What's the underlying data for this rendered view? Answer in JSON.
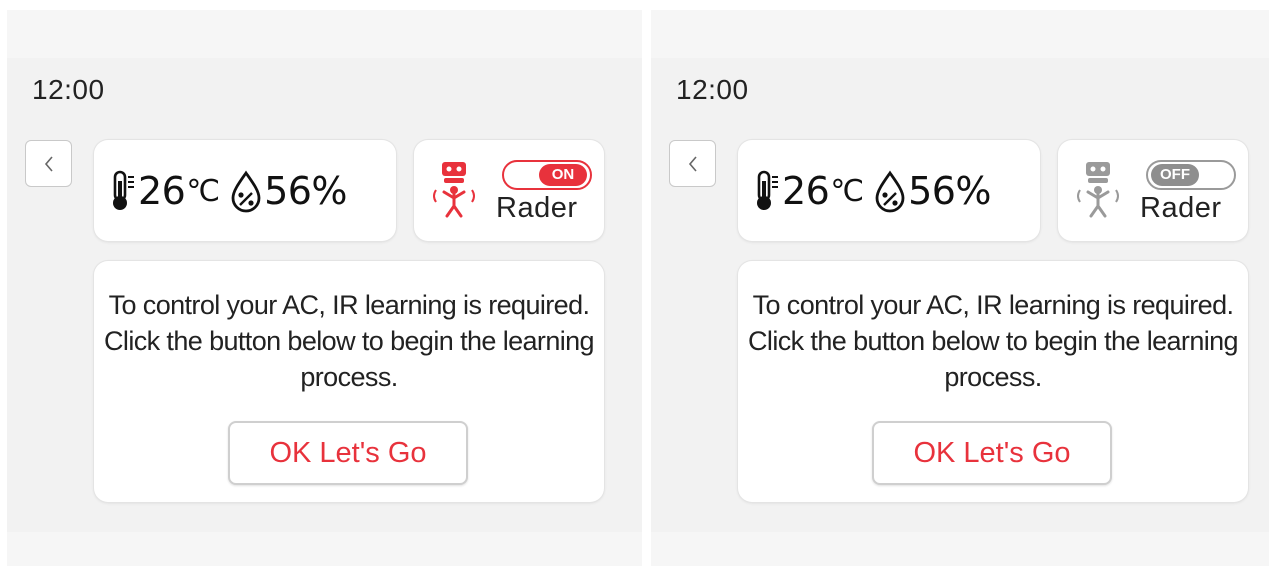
{
  "screens": [
    {
      "time": "12:00",
      "temperature": "26",
      "temperature_unit": "℃",
      "humidity": "56%",
      "radar_label": "Rader",
      "radar_toggle_label": "ON",
      "radar_on": true,
      "message": "To control your AC, IR learning is required. Click the button below to begin the learning process.",
      "button_label": "OK Let's Go"
    },
    {
      "time": "12:00",
      "temperature": "26",
      "temperature_unit": "℃",
      "humidity": "56%",
      "radar_label": "Rader",
      "radar_toggle_label": "OFF",
      "radar_on": false,
      "message": "To control your AC, IR learning is required. Click the button below to begin the learning process.",
      "button_label": "OK Let's Go"
    }
  ],
  "icons": {
    "back": "chevron-left-icon",
    "temperature": "thermometer-icon",
    "humidity": "water-drop-percent-icon",
    "radar": "radar-person-icon"
  },
  "colors": {
    "accent": "#e8323c",
    "off": "#8e8e8e",
    "background": "#f2f2f2",
    "card": "#ffffff"
  }
}
